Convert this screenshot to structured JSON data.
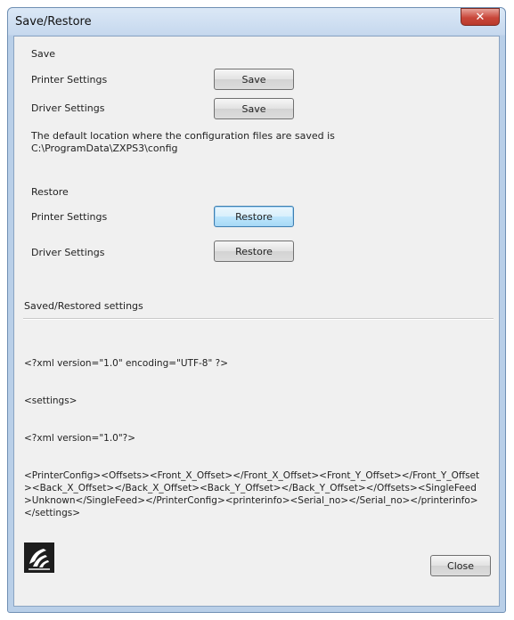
{
  "window": {
    "title": "Save/Restore",
    "close_glyph": "✕"
  },
  "save_section": {
    "heading": "Save",
    "printer_label": "Printer Settings",
    "printer_button": "Save",
    "driver_label": "Driver Settings",
    "driver_button": "Save",
    "location_note_line1": "The default location where the configuration files are saved is",
    "location_note_line2": "C:\\ProgramData\\ZXPS3\\config"
  },
  "restore_section": {
    "heading": "Restore",
    "printer_label": "Printer Settings",
    "printer_button": "Restore",
    "driver_label": "Driver Settings",
    "driver_button": "Restore"
  },
  "log": {
    "heading": "Saved/Restored settings",
    "lines": [
      "<?xml version=\"1.0\" encoding=\"UTF-8\" ?>",
      "<settings>",
      "<?xml version=\"1.0\"?>",
      "<PrinterConfig><Offsets><Front_X_Offset></Front_X_Offset><Front_Y_Offset></Front_Y_Offset><Back_X_Offset></Back_X_Offset><Back_Y_Offset></Back_Y_Offset></Offsets><SingleFeed>Unknown</SingleFeed></PrinterConfig><printerinfo><Serial_no></Serial_no></printerinfo></settings>"
    ]
  },
  "footer": {
    "close_button": "Close",
    "logo_icon": "zebra-logo-icon"
  }
}
